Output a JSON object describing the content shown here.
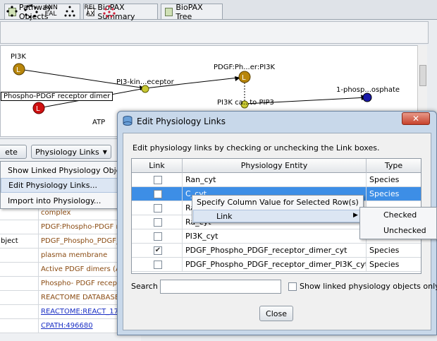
{
  "tabs": [
    {
      "label": "Pathway Objects"
    },
    {
      "label": "BioPAX Summary"
    },
    {
      "label": "BioPAX Tree"
    }
  ],
  "toolbar": {
    "ann_label": "ANN\nEAL",
    "rel_label": "REL\nAX"
  },
  "canvas": {
    "nodes": {
      "pi3k": "PI3K",
      "pdgf_ph": "PDGF:Ph...er:PI3K",
      "pi3_kin": "PI3-kin...eceptor",
      "phospho_pdgf": "Phospho-PDGF receptor dimer",
      "pi3k_ca": "PI3K ca...to PIP3",
      "phosp": "1-phosp...osphate",
      "atp": "ATP"
    }
  },
  "lower_panel": {
    "delete_label": "ete",
    "physiology_links_label": "Physiology Links",
    "menu_items": [
      "Show Linked Physiology Objects",
      "Edit Physiology Links...",
      "Import into Physiology..."
    ],
    "rows": [
      {
        "c1": "",
        "c2": "complex",
        "link": false
      },
      {
        "c1": "",
        "c2": "PDGF:Phospho-PDGF r",
        "link": false
      },
      {
        "c1": "bject",
        "c2": "PDGF_Phospho_PDGF_",
        "link": false
      },
      {
        "c1": "",
        "c2": "plasma membrane",
        "link": false
      },
      {
        "c1": "",
        "c2": "Active PDGF dimers (A",
        "link": false
      },
      {
        "c1": "",
        "c2": "Phospho- PDGF recept",
        "link": false
      },
      {
        "c1": "",
        "c2": "REACTOME DATABASE",
        "link": false
      },
      {
        "c1": "",
        "c2": "REACTOME:REACT_17",
        "link": true
      },
      {
        "c1": "",
        "c2": "CPATH:496680",
        "link": true
      }
    ]
  },
  "dialog": {
    "title": "Edit Physiology Links",
    "instructions": "Edit physiology links by checking or unchecking the Link boxes.",
    "columns": [
      "Link",
      "Physiology Entity",
      "Type"
    ],
    "rows": [
      {
        "entity": "Ran_cyt",
        "type": "Species",
        "checked": false,
        "selected": false
      },
      {
        "entity": "C_cyt",
        "type": "Species",
        "checked": false,
        "selected": true
      },
      {
        "entity": "Ra",
        "type": "",
        "checked": false,
        "selected": false
      },
      {
        "entity": "Ra_cyt",
        "type": "",
        "checked": false,
        "selected": false
      },
      {
        "entity": "PI3K_cyt",
        "type": "",
        "checked": false,
        "selected": false
      },
      {
        "entity": "PDGF_Phospho_PDGF_receptor_dimer_cyt",
        "type": "Species",
        "checked": true,
        "selected": false
      },
      {
        "entity": "PDGF_Phospho_PDGF_receptor_dimer_PI3K_cyt",
        "type": "Species",
        "checked": false,
        "selected": false
      }
    ],
    "context_menu": {
      "item1": "Specify Column Value for Selected Row(s)",
      "item2": "Link",
      "submenu": [
        "Checked",
        "Unchecked"
      ]
    },
    "search_label": "Search",
    "search_value": "",
    "show_linked_label": "Show linked physiology objects only",
    "close_label": "Close"
  }
}
